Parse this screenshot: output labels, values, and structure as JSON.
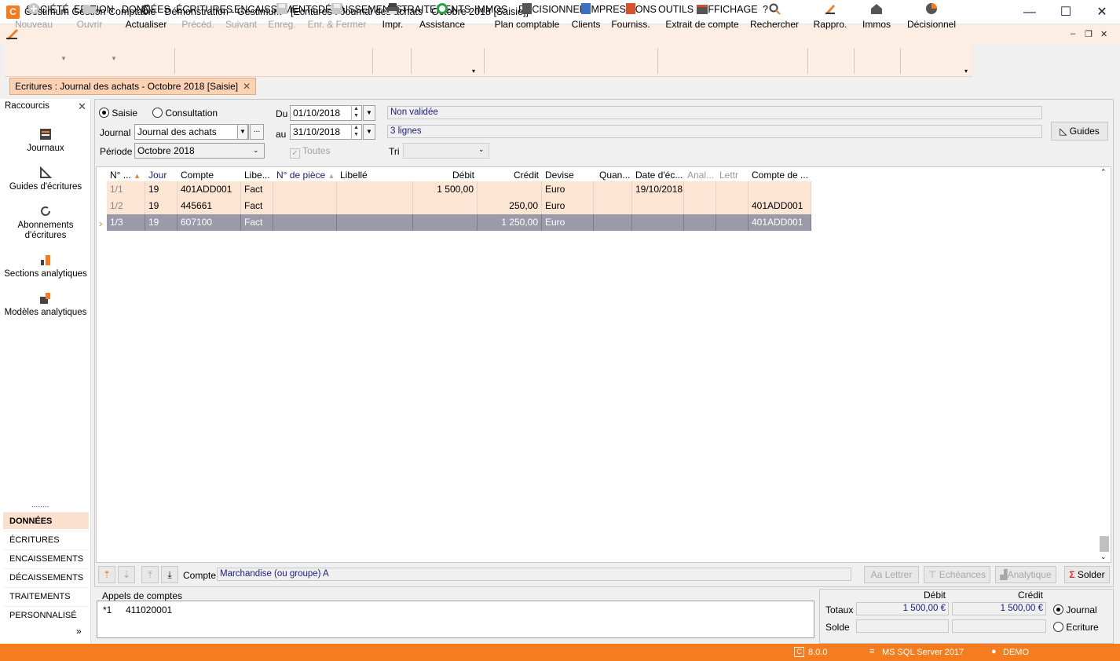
{
  "window": {
    "title": "Gestimum Gestion Comptable - Démonstration - Gestimum - [Ecritures : Journal des achats - Octobre 2018 [Saisie]]",
    "app_icon": "C",
    "minimize": "—",
    "maximize": "☐",
    "close": "✕"
  },
  "menubar": {
    "items": [
      "SOCIÉTÉ",
      "EDITION",
      "DONNÉES",
      "ÉCRITURES",
      "ENCAISSEMENTS",
      "DÉCAISSEMENTS",
      "TRAITEMENTS",
      "IMMOS",
      "DÉCISIONNEL",
      "IMPRESSIONS",
      "OUTILS",
      "AFFICHAGE",
      "?"
    ],
    "mdi_min": "‒",
    "mdi_restore": "❐",
    "mdi_close": "✕"
  },
  "toolbar": {
    "nouveau": "Nouveau",
    "ouvrir": "Ouvrir",
    "actualiser": "Actualiser",
    "preced": "Précéd.",
    "suivant": "Suivant",
    "enreg": "Enreg.",
    "enr_fermer": "Enr. & Fermer",
    "impr": "Impr.",
    "assistance": "Assistance",
    "plan_comptable": "Plan comptable",
    "clients": "Clients",
    "fourniss": "Fourniss.",
    "extrait": "Extrait de compte",
    "rechercher": "Rechercher",
    "rappro": "Rappro.",
    "immos": "Immos",
    "decisionnel": "Décisionnel"
  },
  "doc_tab": {
    "label": "Ecritures : Journal des achats - Octobre 2018 [Saisie]",
    "close": "✕"
  },
  "sidebar": {
    "header": "Raccourcis",
    "close": "✕",
    "shortcuts": [
      "Journaux",
      "Guides d'écritures",
      "Abonnements d'écritures",
      "Sections analytiques",
      "Modèles analytiques"
    ],
    "grip": "........",
    "nav": [
      "DONNÉES",
      "ÉCRITURES",
      "ENCAISSEMENTS",
      "DÉCAISSEMENTS",
      "TRAITEMENTS",
      "PERSONNALISÉ"
    ],
    "more": "»"
  },
  "form": {
    "mode_saisie": "Saisie",
    "mode_consultation": "Consultation",
    "journal_label": "Journal",
    "journal_value": "Journal des achats",
    "journal_browse": "...",
    "periode_label": "Période",
    "periode_value": "Octobre 2018",
    "du_label": "Du",
    "du_value": "01/10/2018",
    "au_label": "au",
    "au_value": "31/10/2018",
    "toutes_label": "Toutes",
    "status": "Non validée",
    "lines": "3 lignes",
    "tri_label": "Tri",
    "tri_value": "",
    "guides_button": "Guides"
  },
  "grid": {
    "columns": [
      "N° ...",
      "Jour",
      "Compte",
      "Libe...",
      "N° de pièce",
      "Libellé",
      "Débit",
      "Crédit",
      "Devise",
      "Quan...",
      "Date d'éc...",
      "Anal...",
      "Lettr",
      "Compte de ..."
    ],
    "rows": [
      {
        "num": "1/1",
        "jour": "19",
        "compte": "401ADD001",
        "libe": "Fact",
        "piece": "",
        "libelle": "",
        "debit": "1 500,00",
        "credit": "",
        "devise": "Euro",
        "quan": "",
        "date": "19/10/2018",
        "anal": "",
        "lettr": "",
        "compte_de": ""
      },
      {
        "num": "1/2",
        "jour": "19",
        "compte": "445661",
        "libe": "Fact",
        "piece": "",
        "libelle": "",
        "debit": "",
        "credit": "250,00",
        "devise": "Euro",
        "quan": "",
        "date": "",
        "anal": "",
        "lettr": "",
        "compte_de": "401ADD001"
      },
      {
        "num": "1/3",
        "jour": "19",
        "compte": "607100",
        "libe": "Fact",
        "piece": "",
        "libelle": "",
        "debit": "",
        "credit": "1 250,00",
        "devise": "Euro",
        "quan": "",
        "date": "",
        "anal": "",
        "lettr": "",
        "compte_de": "401ADD001"
      }
    ],
    "current_marker": "›"
  },
  "bottombar": {
    "compte_label": "Compte",
    "compte_value": "Marchandise (ou groupe) A",
    "lettrer": "Lettrer",
    "echeances": "Echéances",
    "analytique": "Analytique",
    "solder": "Solder"
  },
  "appels": {
    "title": "Appels de comptes",
    "line_key": "*1",
    "line_value": "411020001"
  },
  "totals": {
    "debit_header": "Débit",
    "credit_header": "Crédit",
    "totaux_label": "Totaux",
    "totaux_debit": "1 500,00 €",
    "totaux_credit": "1 500,00 €",
    "solde_label": "Solde",
    "solde_debit": "",
    "solde_credit": "",
    "opt_journal": "Journal",
    "opt_ecriture": "Ecriture"
  },
  "statusbar": {
    "version": "8.0.0",
    "server": "MS SQL Server 2017",
    "user": "DEMO"
  },
  "colors": {
    "accent": "#f57d1f",
    "menubar_bg": "#fdeee3",
    "row_bg": "#fde5d3",
    "row_selected": "#9a9aa8",
    "info_text": "#1c1c80"
  }
}
